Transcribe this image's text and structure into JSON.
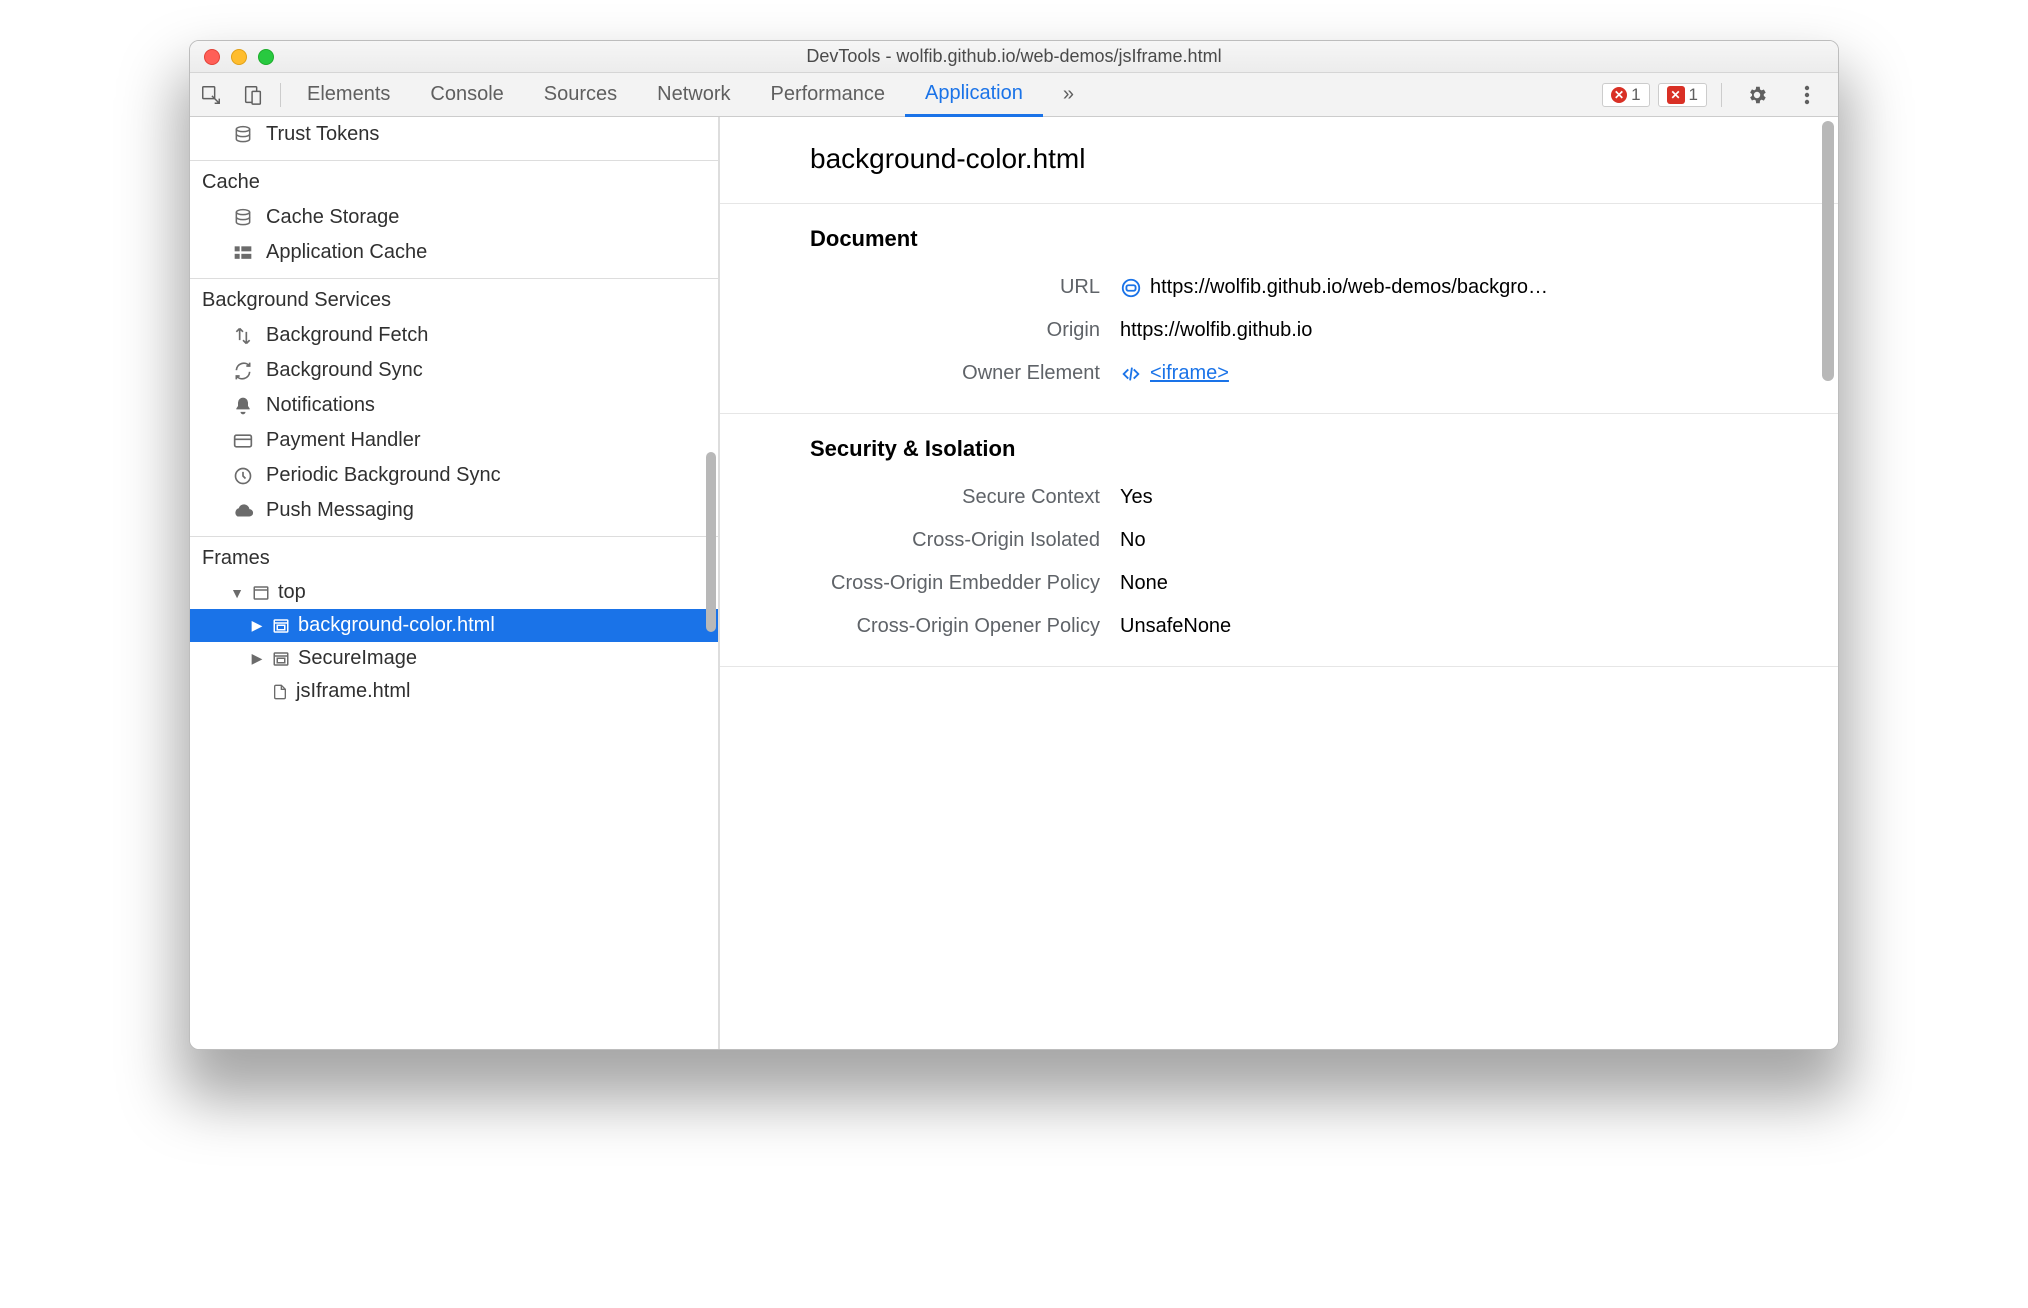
{
  "window": {
    "title": "DevTools - wolfib.github.io/web-demos/jsIframe.html"
  },
  "tabbar": {
    "tabs": [
      "Elements",
      "Console",
      "Sources",
      "Network",
      "Performance",
      "Application"
    ],
    "active": "Application",
    "error_count": "1",
    "issue_count": "1"
  },
  "sidebar": {
    "trust_tokens": "Trust Tokens",
    "cache": {
      "title": "Cache",
      "items": [
        "Cache Storage",
        "Application Cache"
      ]
    },
    "bg_services": {
      "title": "Background Services",
      "items": [
        "Background Fetch",
        "Background Sync",
        "Notifications",
        "Payment Handler",
        "Periodic Background Sync",
        "Push Messaging"
      ]
    },
    "frames": {
      "title": "Frames",
      "top": "top",
      "children": [
        "background-color.html",
        "SecureImage",
        "jsIframe.html"
      ]
    }
  },
  "main": {
    "title": "background-color.html",
    "document": {
      "heading": "Document",
      "url_label": "URL",
      "url_value": "https://wolfib.github.io/web-demos/backgro…",
      "origin_label": "Origin",
      "origin_value": "https://wolfib.github.io",
      "owner_label": "Owner Element",
      "owner_value": "<iframe>"
    },
    "security": {
      "heading": "Security & Isolation",
      "rows": [
        {
          "k": "Secure Context",
          "v": "Yes"
        },
        {
          "k": "Cross-Origin Isolated",
          "v": "No"
        },
        {
          "k": "Cross-Origin Embedder Policy",
          "v": "None"
        },
        {
          "k": "Cross-Origin Opener Policy",
          "v": "UnsafeNone"
        }
      ]
    }
  }
}
